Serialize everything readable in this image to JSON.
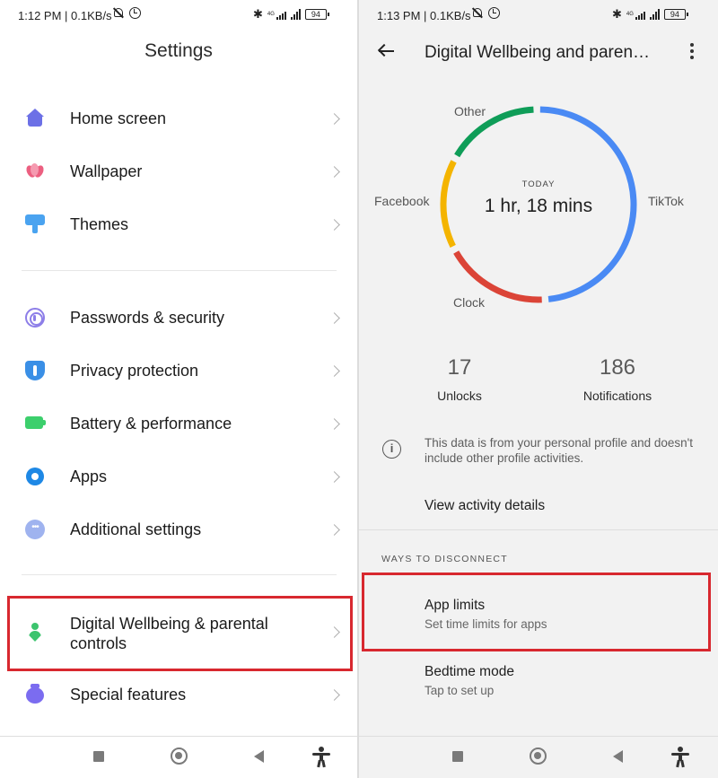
{
  "left": {
    "status": {
      "time": "1:12 PM",
      "speed": "0.1KB/s",
      "network": "4G",
      "battery": "94"
    },
    "title": "Settings",
    "items": [
      {
        "label": "Home screen",
        "icon": "home-icon"
      },
      {
        "label": "Wallpaper",
        "icon": "wallpaper-icon"
      },
      {
        "label": "Themes",
        "icon": "themes-icon"
      },
      {
        "label": "Passwords & security",
        "icon": "fingerprint-icon"
      },
      {
        "label": "Privacy protection",
        "icon": "shield-icon"
      },
      {
        "label": "Battery & performance",
        "icon": "battery-icon"
      },
      {
        "label": "Apps",
        "icon": "gear-icon"
      },
      {
        "label": "Additional settings",
        "icon": "more-dots-icon"
      },
      {
        "label_line1": "Digital Wellbeing & parental",
        "label_line2": "controls",
        "icon": "wellbeing-icon"
      },
      {
        "label": "Special features",
        "icon": "special-features-icon"
      }
    ]
  },
  "right": {
    "status": {
      "time": "1:13 PM",
      "speed": "0.1KB/s",
      "network": "4G",
      "battery": "94"
    },
    "title": "Digital Wellbeing and paren…",
    "chart": {
      "today_label": "TODAY",
      "total": "1 hr, 18 mins",
      "segment_labels": {
        "tiktok": "TikTok",
        "clock": "Clock",
        "facebook": "Facebook",
        "other": "Other"
      },
      "colors": {
        "tiktok": "#4a8af4",
        "clock": "#db4437",
        "facebook": "#f4b400",
        "other": "#0f9d58"
      }
    },
    "stats": [
      {
        "value": "17",
        "label": "Unlocks"
      },
      {
        "value": "186",
        "label": "Notifications"
      }
    ],
    "info": "This data is from your personal profile and doesn't include other profile activities.",
    "view_details": "View activity details",
    "section_header": "WAYS TO DISCONNECT",
    "app_limits": {
      "title": "App limits",
      "subtitle": "Set time limits for apps"
    },
    "bedtime": {
      "title": "Bedtime mode",
      "subtitle": "Tap to set up"
    }
  },
  "highlight_color": "#d8282f"
}
